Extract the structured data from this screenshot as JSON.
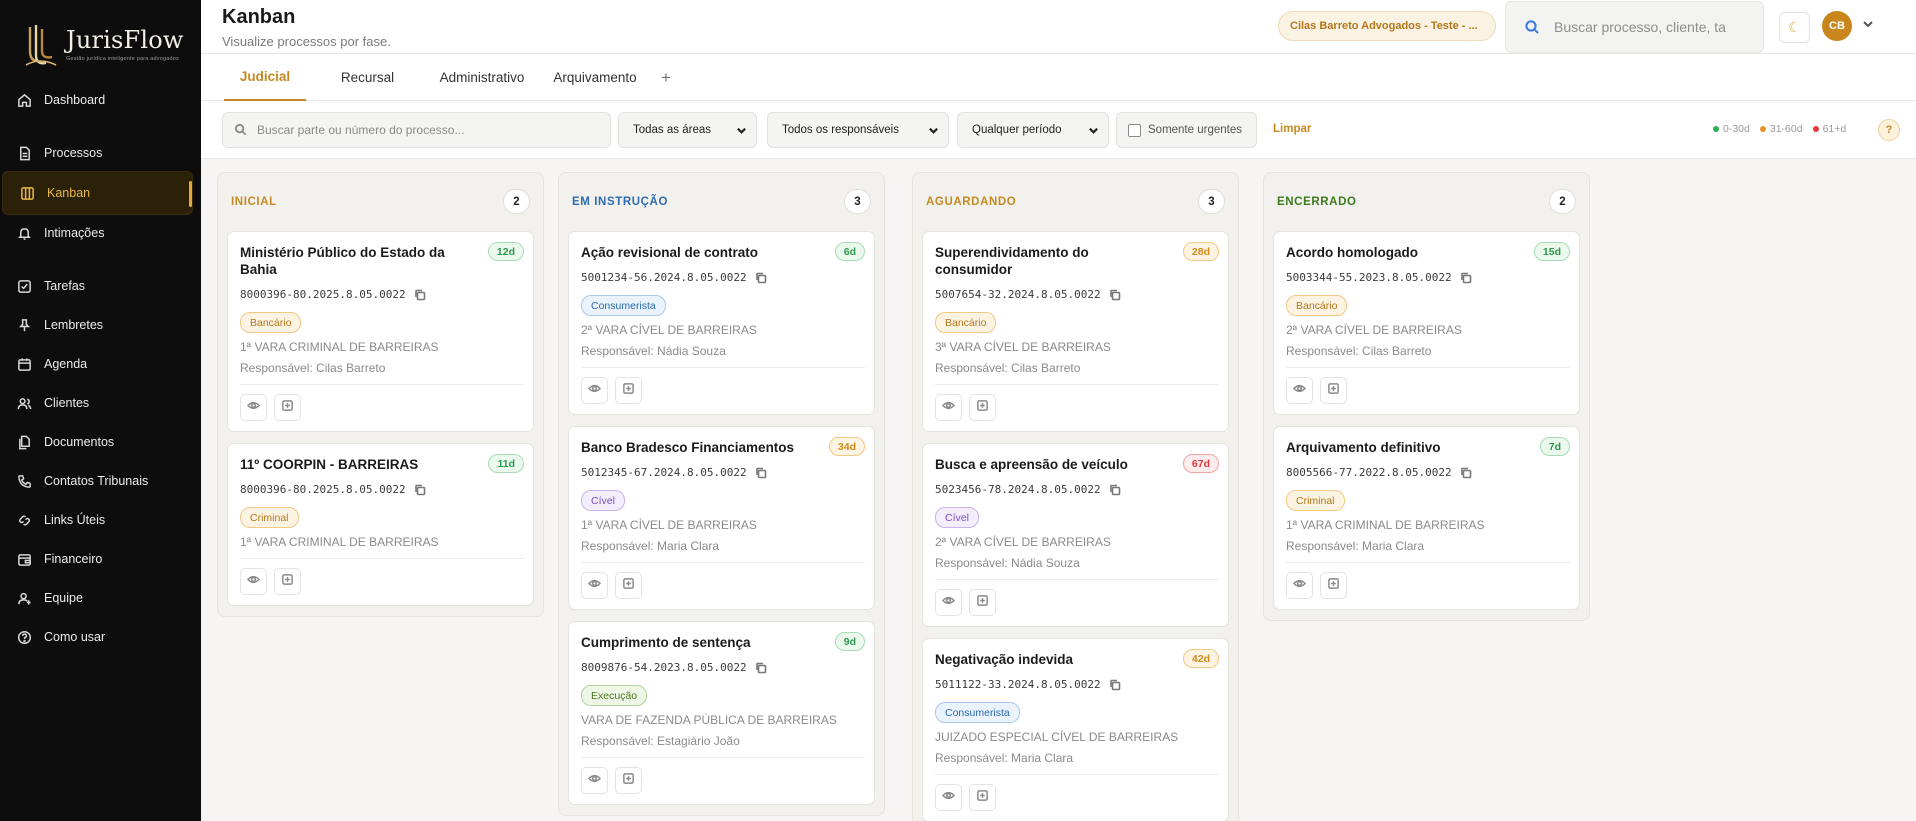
{
  "brand": {
    "name": "JurisFlow",
    "tagline": "Gestão jurídica inteligente para advogados"
  },
  "sidebar": {
    "items": [
      {
        "label": "Dashboard",
        "icon": "home-icon"
      },
      {
        "label": "Processos",
        "icon": "document-icon"
      },
      {
        "label": "Kanban",
        "icon": "kanban-icon",
        "active": true
      },
      {
        "label": "Intimações",
        "icon": "bell-icon"
      },
      {
        "label": "Tarefas",
        "icon": "checkbox-icon"
      },
      {
        "label": "Lembretes",
        "icon": "pin-icon"
      },
      {
        "label": "Agenda",
        "icon": "calendar-icon"
      },
      {
        "label": "Clientes",
        "icon": "users-icon"
      },
      {
        "label": "Documentos",
        "icon": "files-icon"
      },
      {
        "label": "Contatos Tribunais",
        "icon": "phone-icon"
      },
      {
        "label": "Links Úteis",
        "icon": "link-icon"
      },
      {
        "label": "Financeiro",
        "icon": "wallet-icon"
      },
      {
        "label": "Equipe",
        "icon": "user-add-icon"
      },
      {
        "label": "Como usar",
        "icon": "help-circle-icon"
      }
    ]
  },
  "header": {
    "title": "Kanban",
    "subtitle": "Visualize processos por fase.",
    "org": "Cilas Barreto Advogados - Teste - ...",
    "search_placeholder": "Buscar processo, cliente, ta",
    "avatar": "CB"
  },
  "tabs": [
    {
      "label": "Judicial",
      "active": true
    },
    {
      "label": "Recursal"
    },
    {
      "label": "Administrativo"
    },
    {
      "label": "Arquivamento"
    }
  ],
  "tab_add": "+",
  "filters": {
    "search_placeholder": "Buscar parte ou número do processo...",
    "area": "Todas as áreas",
    "responsavel": "Todos os responsáveis",
    "periodo": "Qualquer período",
    "urgentes": "Somente urgentes",
    "clear": "Limpar",
    "legend": [
      {
        "label": "0-30d",
        "color": "#2fae52"
      },
      {
        "label": "31-60d",
        "color": "#e8902a"
      },
      {
        "label": "61+d",
        "color": "#e03a3a"
      }
    ],
    "help": "?"
  },
  "columns": [
    {
      "title": "INICIAL",
      "count": "2",
      "color": "#c58a22",
      "cards": [
        {
          "title": "Ministério Público do Estado da Bahia",
          "number": "8000396-80.2025.8.05.0022",
          "age": "12d",
          "age_level": "green",
          "badge": "Bancário",
          "badge_type": "bancario",
          "court": "1ª VARA CRIMINAL DE BARREIRAS",
          "responsible": "Responsável: Cilas Barreto"
        },
        {
          "title": "11º COORPIN - BARREIRAS",
          "number": "8000396-80.2025.8.05.0022",
          "age": "11d",
          "age_level": "green",
          "badge": "Criminal",
          "badge_type": "criminal",
          "court": "1ª VARA CRIMINAL DE BARREIRAS",
          "responsible": ""
        }
      ]
    },
    {
      "title": "EM INSTRUÇÃO",
      "count": "3",
      "color": "#2c6db0",
      "cards": [
        {
          "title": "Ação revisional de contrato",
          "number": "5001234-56.2024.8.05.0022",
          "age": "6d",
          "age_level": "green",
          "badge": "Consumerista",
          "badge_type": "consumerista",
          "court": "2ª VARA CÍVEL DE BARREIRAS",
          "responsible": "Responsável: Nádia Souza"
        },
        {
          "title": "Banco Bradesco Financiamentos",
          "number": "5012345-67.2024.8.05.0022",
          "age": "34d",
          "age_level": "orange",
          "badge": "Cível",
          "badge_type": "civel",
          "court": "1ª VARA CÍVEL DE BARREIRAS",
          "responsible": "Responsável: Maria Clara"
        },
        {
          "title": "Cumprimento de sentença",
          "number": "8009876-54.2023.8.05.0022",
          "age": "9d",
          "age_level": "green",
          "badge": "Execução",
          "badge_type": "execucao",
          "court": "VARA DE FAZENDA PÚBLICA DE BARREIRAS",
          "responsible": "Responsável: Estagiário João"
        }
      ]
    },
    {
      "title": "AGUARDANDO",
      "count": "3",
      "color": "#c58a22",
      "cards": [
        {
          "title": "Superendividamento do consumidor",
          "number": "5007654-32.2024.8.05.0022",
          "age": "28d",
          "age_level": "orange",
          "badge": "Bancário",
          "badge_type": "bancario",
          "court": "3ª VARA CÍVEL DE BARREIRAS",
          "responsible": "Responsável: Cilas Barreto"
        },
        {
          "title": "Busca e apreensão de veículo",
          "number": "5023456-78.2024.8.05.0022",
          "age": "67d",
          "age_level": "red",
          "badge": "Cível",
          "badge_type": "civel",
          "court": "2ª VARA CÍVEL DE BARREIRAS",
          "responsible": "Responsável: Nádia Souza"
        },
        {
          "title": "Negativação indevida",
          "number": "5011122-33.2024.8.05.0022",
          "age": "42d",
          "age_level": "orange",
          "badge": "Consumerista",
          "badge_type": "consumerista",
          "court": "JUIZADO ESPECIAL CÍVEL DE BARREIRAS",
          "responsible": "Responsável: Maria Clara"
        }
      ]
    },
    {
      "title": "ENCERRADO",
      "count": "2",
      "color": "#3d7a1e",
      "cards": [
        {
          "title": "Acordo homologado",
          "number": "5003344-55.2023.8.05.0022",
          "age": "15d",
          "age_level": "green",
          "badge": "Bancário",
          "badge_type": "bancario",
          "court": "2ª VARA CÍVEL DE BARREIRAS",
          "responsible": "Responsável: Cilas Barreto"
        },
        {
          "title": "Arquivamento definitivo",
          "number": "8005566-77.2022.8.05.0022",
          "age": "7d",
          "age_level": "green",
          "badge": "Criminal",
          "badge_type": "criminal",
          "court": "1ª VARA CRIMINAL DE BARREIRAS",
          "responsible": "Responsável: Maria Clara"
        }
      ]
    }
  ]
}
